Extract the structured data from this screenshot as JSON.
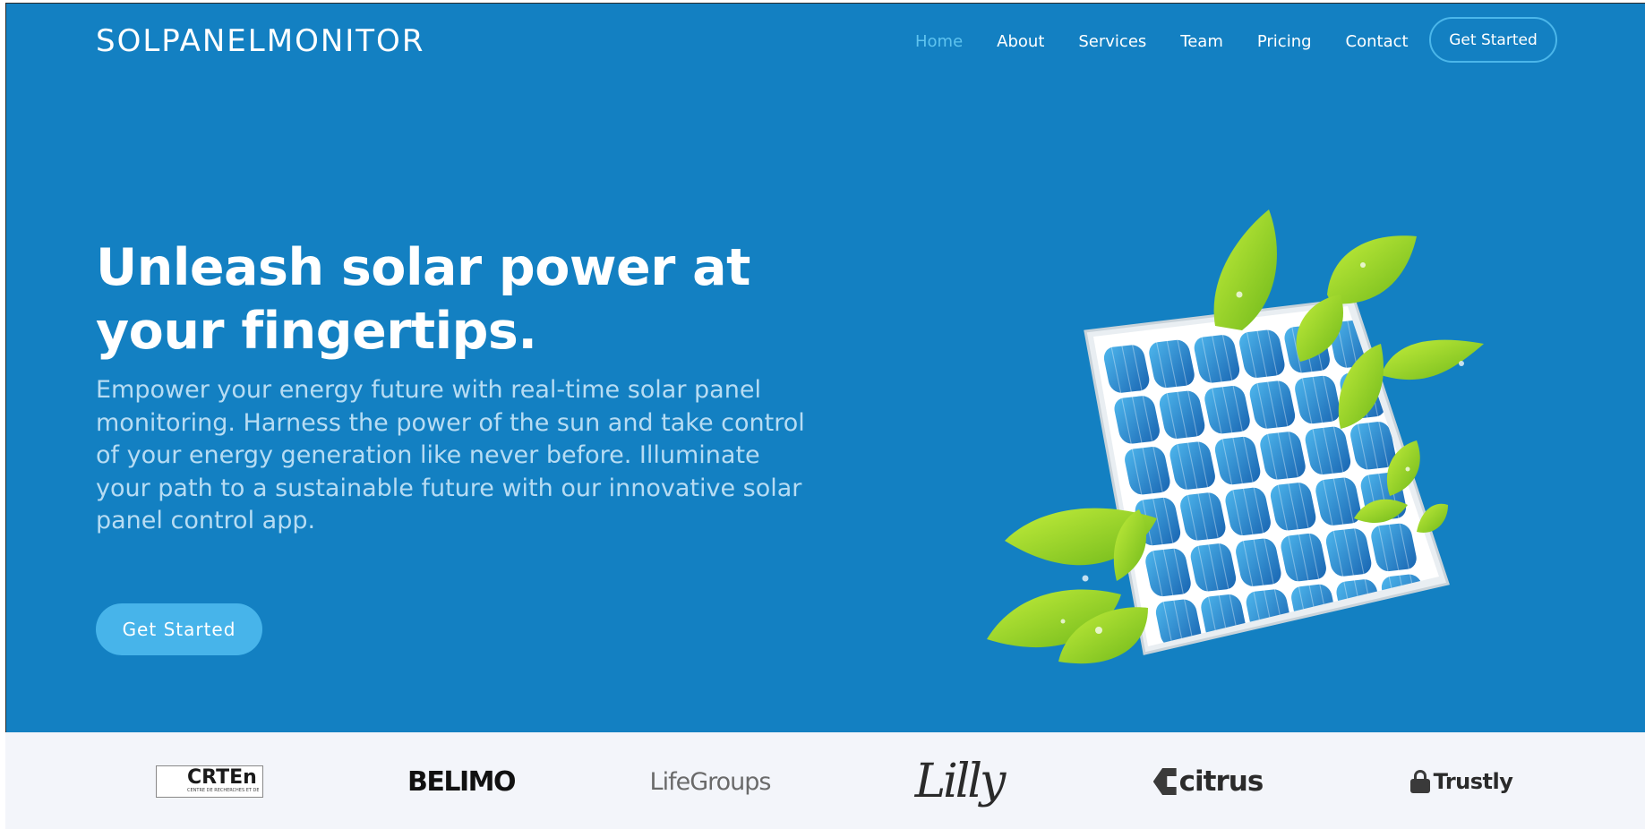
{
  "brand": {
    "logo_text": "SOLPANELMONITOR"
  },
  "nav": {
    "items": [
      {
        "label": "Home",
        "active": true
      },
      {
        "label": "About",
        "active": false
      },
      {
        "label": "Services",
        "active": false
      },
      {
        "label": "Team",
        "active": false
      },
      {
        "label": "Pricing",
        "active": false
      },
      {
        "label": "Contact",
        "active": false
      }
    ],
    "cta_label": "Get Started"
  },
  "hero": {
    "headline": "Unleash solar power at your fingertips.",
    "subtext": "Empower your energy future with real-time solar panel monitoring. Harness the power of the sun and take control of your energy generation like never before. Illuminate your path to a sustainable future with our innovative solar panel control app.",
    "cta_label": "Get Started",
    "image_icon": "solar-panel-with-leaves-illustration"
  },
  "clients": {
    "logos": [
      {
        "name": "CRTEn",
        "subtitle": "CENTRE DE RECHERCHES ET DES TECHNOLOGIES DE L'ENERGIE"
      },
      {
        "name": "BELIMO"
      },
      {
        "name": "LifeGroups"
      },
      {
        "name": "Lilly"
      },
      {
        "name": "citrus"
      },
      {
        "name": "Trustly"
      }
    ]
  },
  "colors": {
    "hero_background": "#1380c2",
    "nav_active": "#5fc3ef",
    "button_accent": "#47b4ea",
    "subtext": "#b7dcf3",
    "clients_background": "#f3f5fa"
  }
}
